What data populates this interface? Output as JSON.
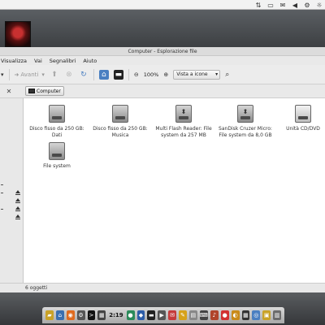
{
  "tray": {
    "icons": [
      "network-icon",
      "battery-icon",
      "mail-icon",
      "volume-icon",
      "settings-icon",
      "brightness-icon"
    ]
  },
  "window": {
    "title": "Computer - Esplorazione file",
    "menu": [
      "Visualizza",
      "Vai",
      "Segnalibri",
      "Aiuto"
    ],
    "toolbar": {
      "forward_label": "Avanti",
      "zoom_level": "100%",
      "view_mode": "Vista a icone"
    },
    "location": {
      "close_glyph": "✕",
      "path_button": "Computer"
    },
    "items": [
      {
        "label": "Disco fisso da 250 GB: Dati",
        "kind": "harddisk"
      },
      {
        "label": "Disco fisso da 250 GB: Musica",
        "kind": "harddisk"
      },
      {
        "label": "Multi Flash Reader: File system da 257 MB",
        "kind": "usb"
      },
      {
        "label": "SanDisk Cruzer Micro: File system da 8,0 GB",
        "kind": "usb"
      },
      {
        "label": "Unità CD/DVD",
        "kind": "optical"
      },
      {
        "label": "File system",
        "kind": "harddisk"
      }
    ],
    "status": "6 oggetti"
  },
  "dock": {
    "time": "2:19",
    "icons": [
      "folder-icon",
      "browser-icon",
      "terminal-icon",
      "chat-icon",
      "text-editor-icon",
      "office-icon",
      "mail-icon",
      "media-icon",
      "trash-icon"
    ]
  },
  "colors": {
    "accent": "#4a7fc1",
    "window_bg": "#ededed",
    "content_bg": "#ffffff"
  }
}
